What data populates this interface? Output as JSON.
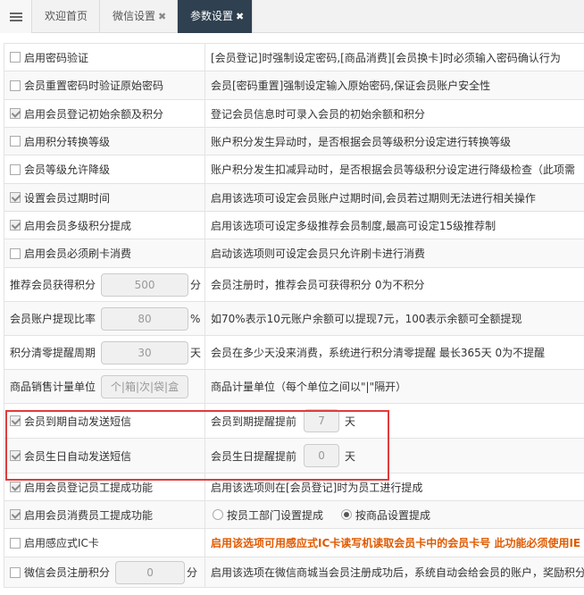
{
  "tabs": [
    {
      "label": "欢迎首页",
      "closable": false,
      "active": false
    },
    {
      "label": "微信设置",
      "closable": true,
      "active": false
    },
    {
      "label": "参数设置",
      "closable": true,
      "active": true
    }
  ],
  "close_glyph": "✖",
  "rows": [
    {
      "type": "check",
      "checked": false,
      "label": "启用密码验证",
      "desc": "[会员登记]时强制设定密码,[商品消费][会员换卡]时必须输入密码确认行为"
    },
    {
      "type": "check",
      "checked": false,
      "label": "会员重置密码时验证原始密码",
      "desc": "会员[密码重置]强制设定输入原始密码,保证会员账户安全性"
    },
    {
      "type": "check",
      "checked": true,
      "label": "启用会员登记初始余额及积分",
      "desc": "登记会员信息时可录入会员的初始余额和积分"
    },
    {
      "type": "check",
      "checked": false,
      "label": "启用积分转换等级",
      "desc": "账户积分发生异动时，是否根据会员等级积分设定进行转换等级"
    },
    {
      "type": "check",
      "checked": false,
      "label": "会员等级允许降级",
      "desc": "账户积分发生扣减异动时，是否根据会员等级积分设定进行降级检查（此项需"
    },
    {
      "type": "check",
      "checked": true,
      "label": "设置会员过期时间",
      "desc": "启用该选项可设定会员账户过期时间,会员若过期则无法进行相关操作"
    },
    {
      "type": "check",
      "checked": true,
      "label": "启用会员多级积分提成",
      "desc": "启用该选项可设定多级推荐会员制度,最高可设定15级推荐制"
    },
    {
      "type": "check",
      "checked": false,
      "label": "启用会员必须刷卡消费",
      "desc": "启动该选项则可设定会员只允许刷卡进行消费"
    },
    {
      "type": "input",
      "label": "推荐会员获得积分",
      "value": "500",
      "unit": "分",
      "desc": "会员注册时，推荐会员可获得积分 0为不积分"
    },
    {
      "type": "input",
      "label": "会员账户提现比率",
      "value": "80",
      "unit": "%",
      "desc": "如70%表示10元账户余额可以提现7元，100表示余额可全额提现"
    },
    {
      "type": "input",
      "label": "积分清零提醒周期",
      "value": "30",
      "unit": "天",
      "desc": "会员在多少天没来消费，系统进行积分清零提醒 最长365天 0为不提醒"
    },
    {
      "type": "input",
      "label": "商品销售计量单位",
      "value": "个|箱|次|袋|盒",
      "unit": "",
      "desc": "商品计量单位（每个单位之间以\"|\"隔开）"
    },
    {
      "type": "check-input",
      "checked": true,
      "label": "会员到期自动发送短信",
      "desc_prefix": "会员到期提醒提前",
      "value": "7",
      "unit": "天"
    },
    {
      "type": "check-input",
      "checked": true,
      "label": "会员生日自动发送短信",
      "desc_prefix": "会员生日提醒提前",
      "value": "0",
      "unit": "天"
    },
    {
      "type": "check",
      "checked": true,
      "label": "启用会员登记员工提成功能",
      "desc": "启用该选项则在[会员登记]时为员工进行提成"
    },
    {
      "type": "radio",
      "checked": true,
      "label": "启用会员消费员工提成功能",
      "options": [
        {
          "label": "按员工部门设置提成",
          "on": false
        },
        {
          "label": "按商品设置提成",
          "on": true
        }
      ]
    },
    {
      "type": "check",
      "checked": false,
      "label": "启用感应式IC卡",
      "desc": "启用该选项可用感应式IC卡读写机读取会员卡中的会员卡号 此功能必须使用IE",
      "warn": true
    },
    {
      "type": "check-input2",
      "checked": false,
      "label": "微信会员注册积分",
      "value": "0",
      "unit": "分",
      "desc": "启用该选项在微信商城当会员注册成功后，系统自动会给会员的账户，奖励积分"
    }
  ]
}
